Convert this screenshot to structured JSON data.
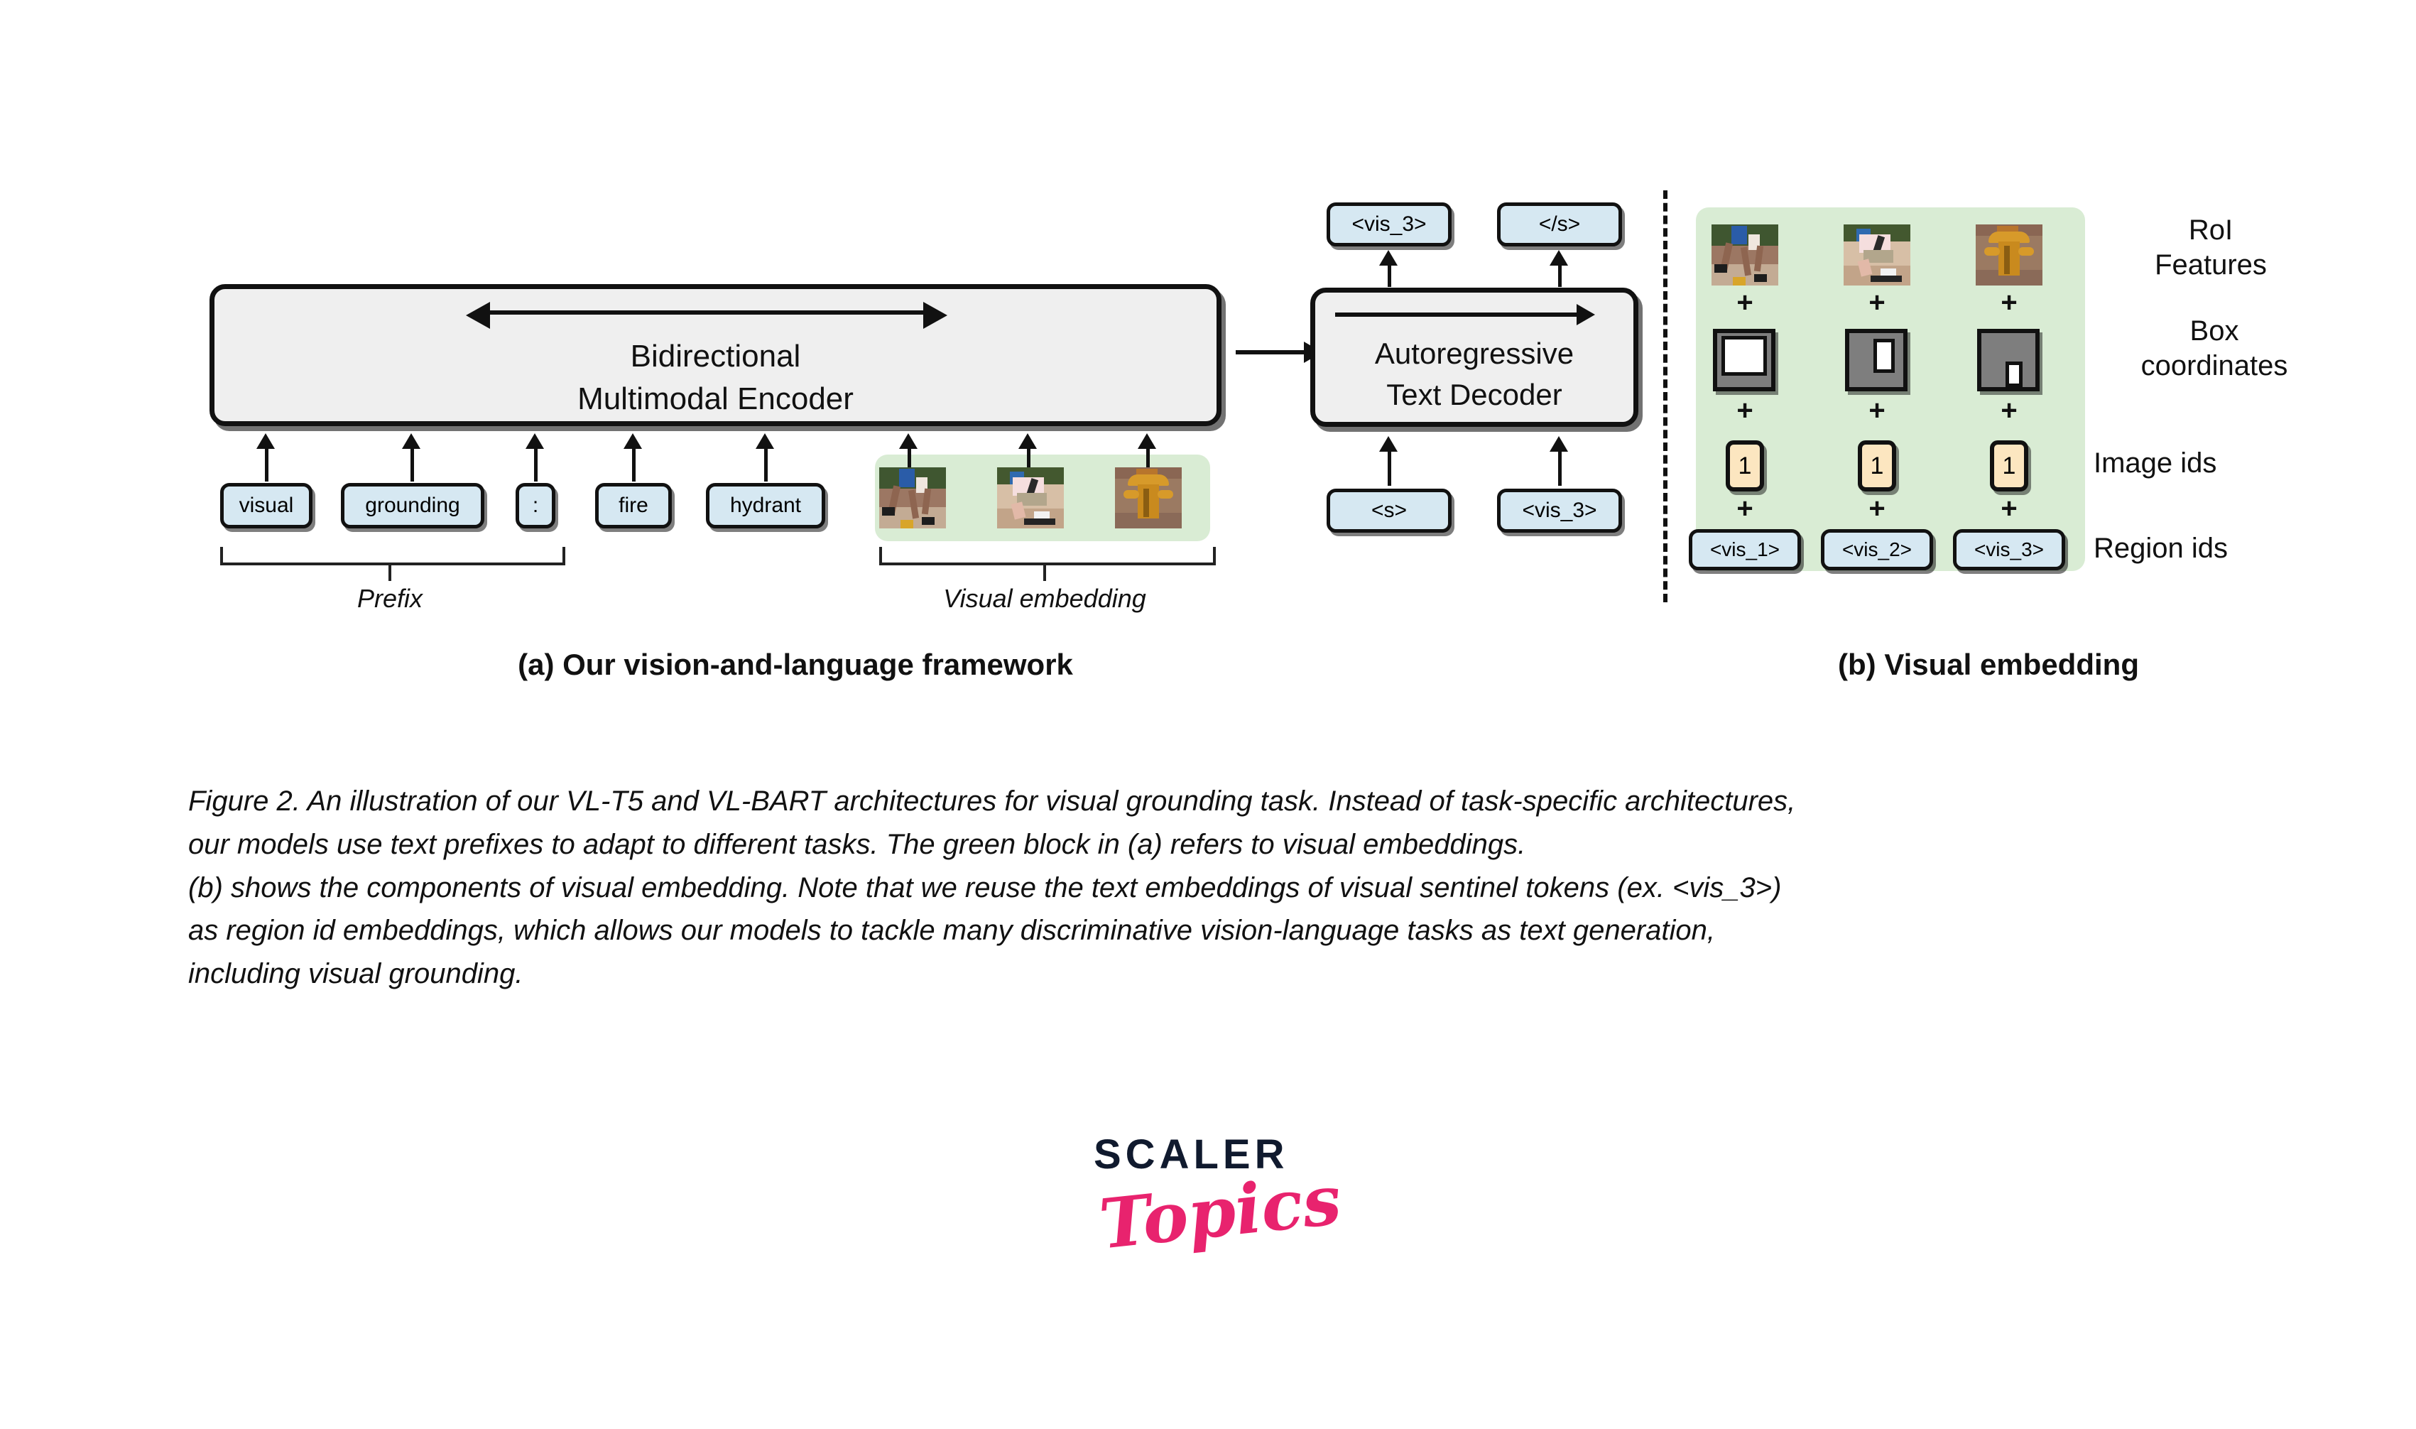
{
  "figure": {
    "sub_caption_a": "(a) Our vision-and-language framework",
    "sub_caption_b": "(b) Visual embedding",
    "caption_lines": [
      "Figure 2. An illustration of our VL-T5 and VL-BART architectures for visual grounding task. Instead of task-specific architectures,",
      "our models use text prefixes to adapt to different tasks. The green block in (a) refers to visual embeddings.",
      "(b) shows the components of visual embedding. Note that we reuse the text embeddings of visual sentinel tokens (ex. <vis_3>)",
      "as region id embeddings, which allows our models to tackle many discriminative vision-language tasks as text generation,",
      "including visual grounding."
    ]
  },
  "encoder": {
    "line1": "Bidirectional",
    "line2": "Multimodal Encoder",
    "arrow": "bidirectional-arrow"
  },
  "decoder": {
    "line1": "Autoregressive",
    "line2": "Text Decoder",
    "arrow": "rightward-arrow"
  },
  "input_tokens": [
    {
      "label": "visual",
      "kind": "text"
    },
    {
      "label": "grounding",
      "kind": "text"
    },
    {
      "label": ":",
      "kind": "text"
    },
    {
      "label": "fire",
      "kind": "text"
    },
    {
      "label": "hydrant",
      "kind": "text"
    }
  ],
  "visual_embedding_thumbs": [
    {
      "alt": "skateboarder-legs-thumbnail"
    },
    {
      "alt": "person-on-skateboard-thumbnail"
    },
    {
      "alt": "yellow-fire-hydrant-thumbnail"
    }
  ],
  "brackets": {
    "prefix": "Prefix",
    "visual_embedding": "Visual embedding"
  },
  "decoder_outputs": [
    {
      "label": "<vis_3>"
    },
    {
      "label": "</s>"
    }
  ],
  "decoder_inputs": [
    {
      "label": "<s>"
    },
    {
      "label": "<vis_3>"
    }
  ],
  "panel_b": {
    "row_labels": {
      "roi": "RoI\nFeatures",
      "roi_line1": "RoI",
      "roi_line2": "Features",
      "box_line1": "Box",
      "box_line2": "coordinates",
      "image_ids": "Image ids",
      "region_ids": "Region ids"
    },
    "plus_symbol": "+",
    "image_ids": [
      "1",
      "1",
      "1"
    ],
    "region_ids": [
      "<vis_1>",
      "<vis_2>",
      "<vis_3>"
    ],
    "box_coordinates": [
      {
        "name": "box-coordinate-region-1"
      },
      {
        "name": "box-coordinate-region-2"
      },
      {
        "name": "box-coordinate-region-3"
      }
    ]
  },
  "logo": {
    "word_mark": "SCALER",
    "script_mark": "Topics"
  },
  "colors": {
    "token_fill": "#d6e8f2",
    "module_fill": "#efefef",
    "green_plate": "#d9ecd4",
    "id_chip_fill": "#fce6c0",
    "ink": "#111111",
    "logo_dark": "#101a2e",
    "logo_pink": "#e8236e"
  }
}
